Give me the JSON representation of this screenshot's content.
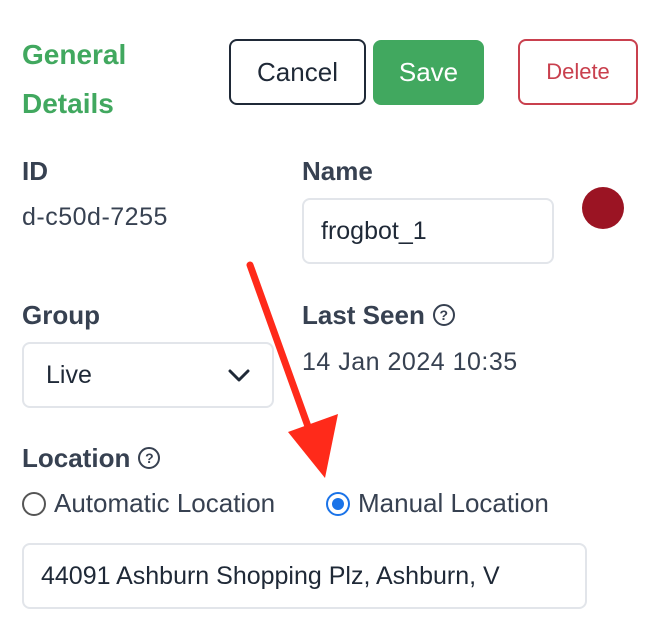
{
  "header": {
    "title_line1": "General",
    "title_line2": "Details",
    "cancel_label": "Cancel",
    "save_label": "Save",
    "delete_label": "Delete"
  },
  "fields": {
    "id_label": "ID",
    "id_value": "d-c50d-7255",
    "name_label": "Name",
    "name_value": "frogbot_1",
    "group_label": "Group",
    "group_value": "Live",
    "last_seen_label": "Last Seen",
    "last_seen_value": "14 Jan 2024 10:35",
    "location_label": "Location",
    "location_options": [
      "Automatic Location",
      "Manual Location"
    ],
    "location_selected": "Manual Location",
    "address_value": "44091 Ashburn Shopping Plz, Ashburn, V"
  },
  "colors": {
    "accent_green": "#41a85f",
    "danger_red": "#c9404e",
    "status_dot": "#9b1423",
    "annotation_arrow": "#ff2a1a"
  },
  "icons": {
    "help": "question-circle-icon",
    "select_chevron": "chevron-down-icon"
  }
}
